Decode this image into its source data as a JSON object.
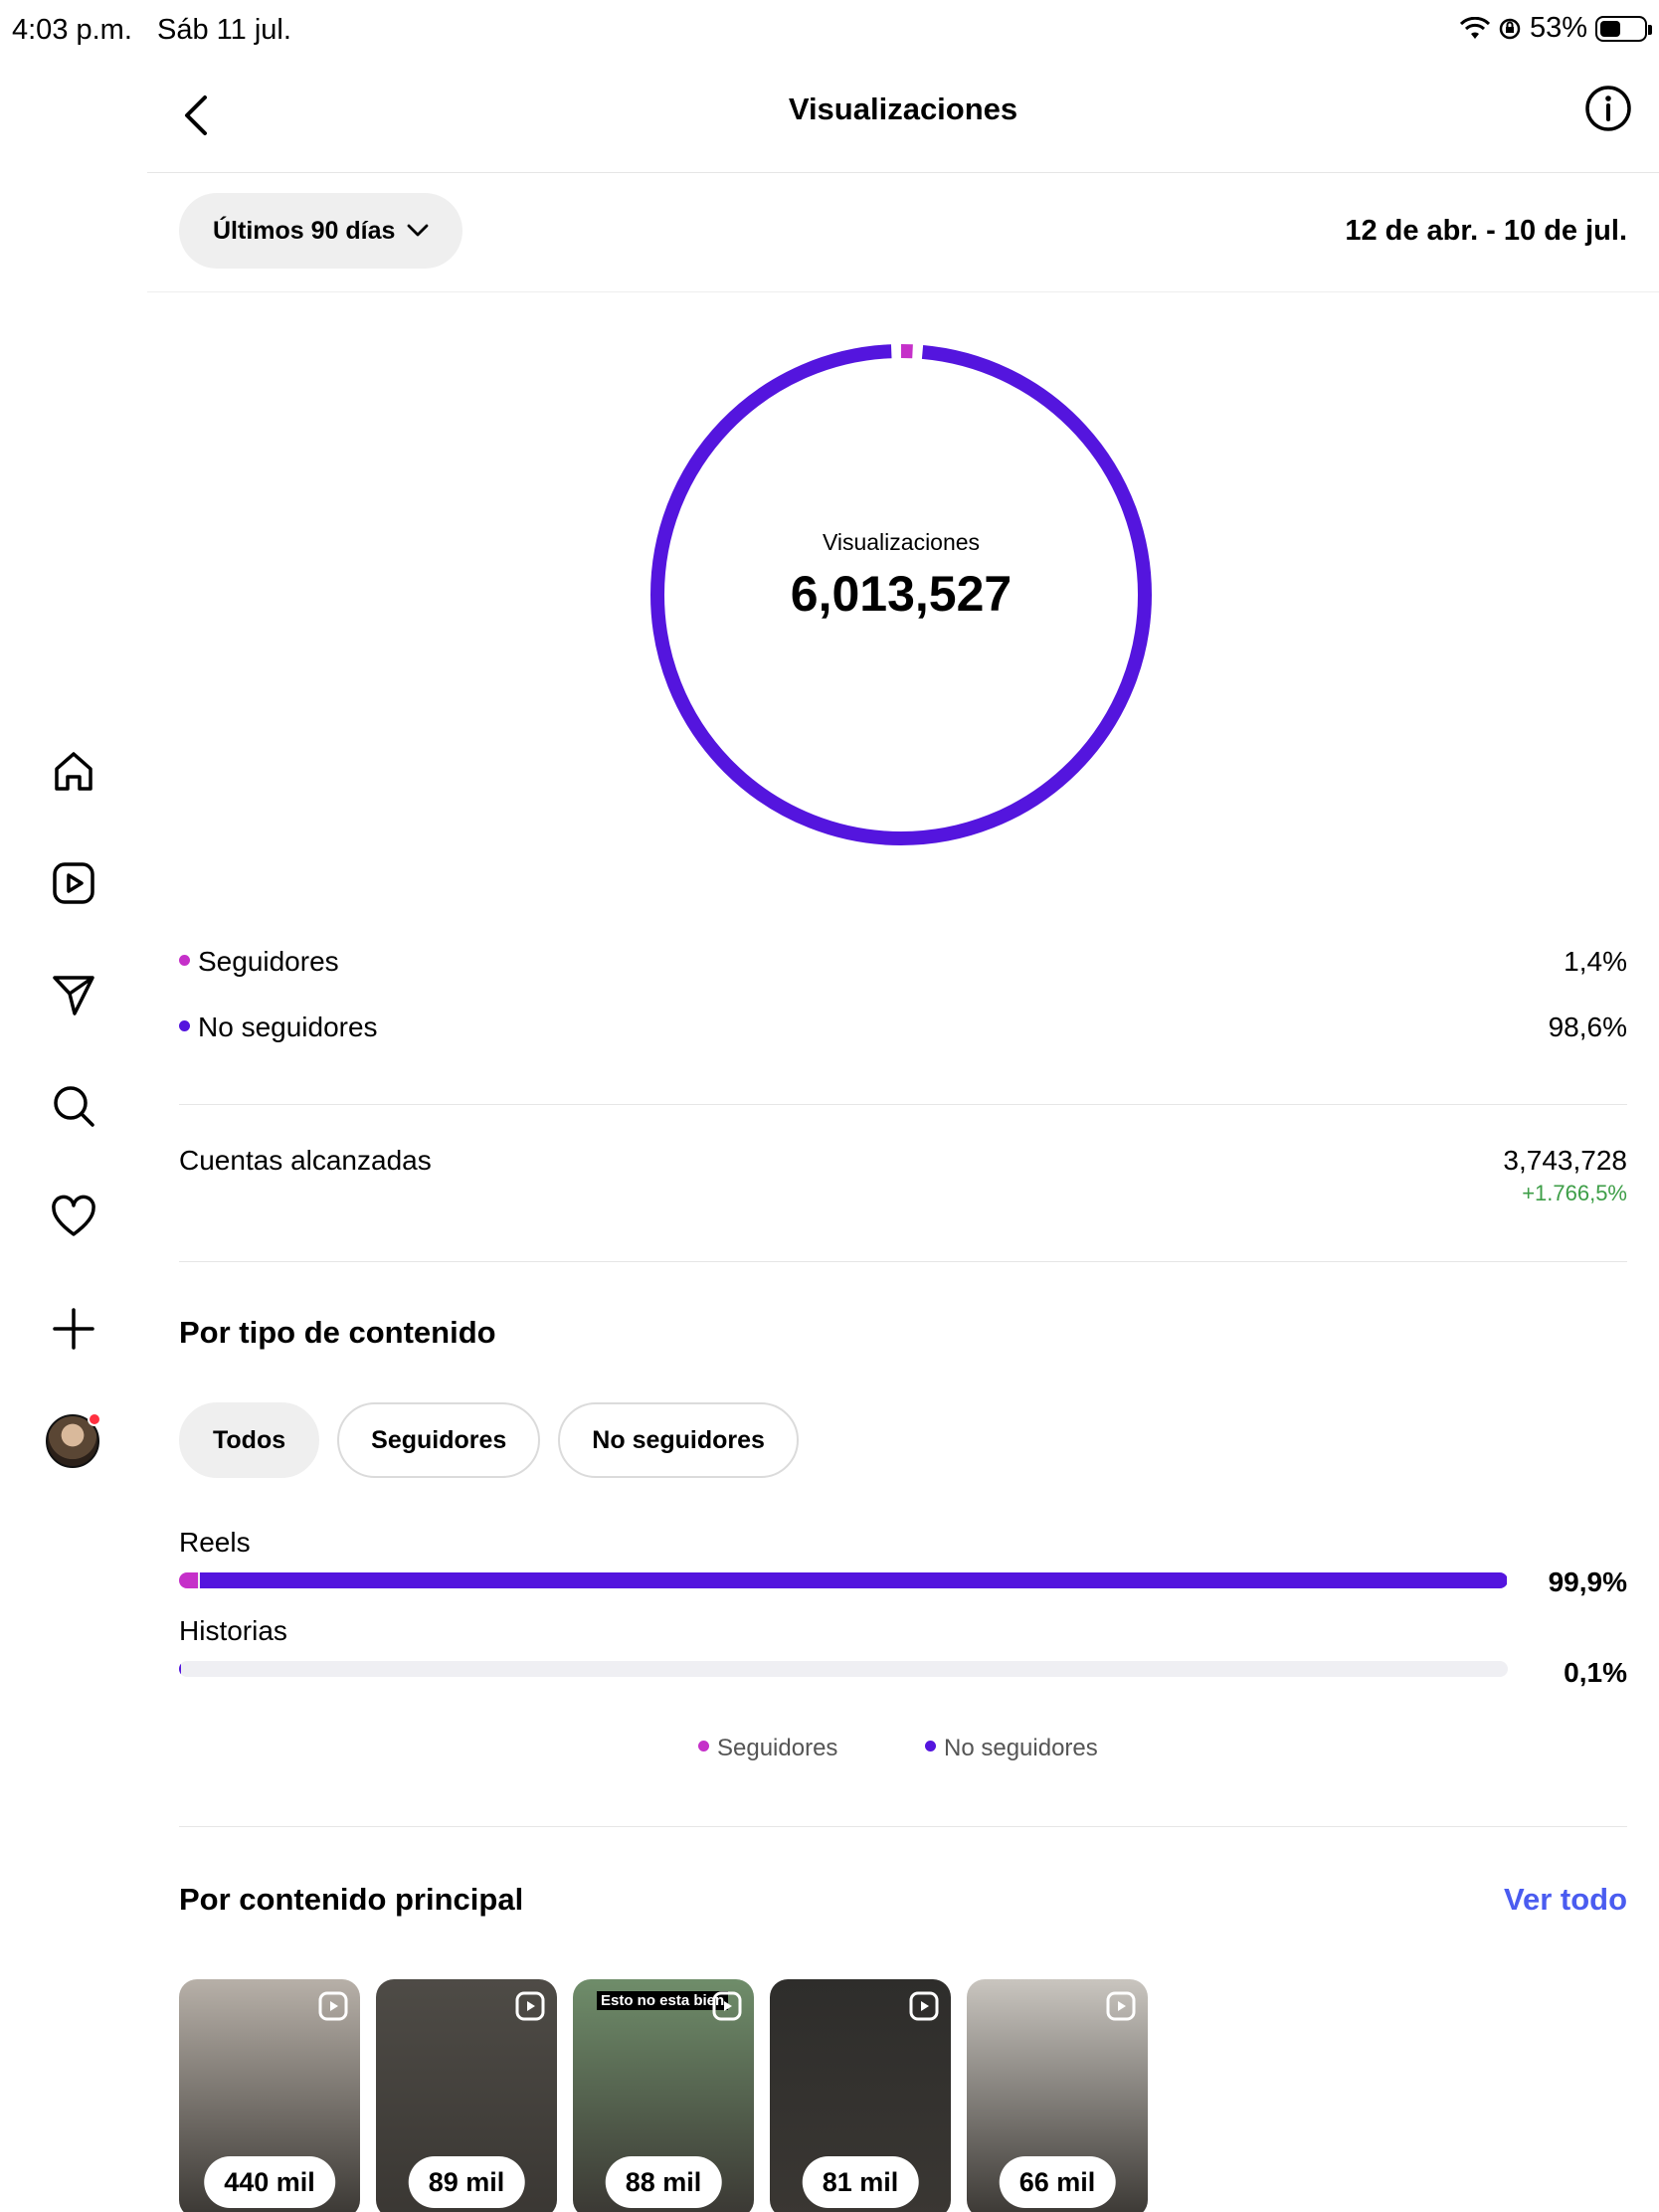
{
  "status_bar": {
    "time": "4:03 p.m.",
    "date": "Sáb 11 jul.",
    "battery": "53%"
  },
  "header": {
    "title": "Visualizaciones"
  },
  "period": {
    "selector_label": "Últimos 90 días",
    "range": "12 de abr. - 10 de jul."
  },
  "summary": {
    "center_label": "Visualizaciones",
    "center_value": "6,013,527"
  },
  "audience": [
    {
      "label": "Seguidores",
      "value": "1,4%",
      "color": "#c530c9",
      "share": 0.014
    },
    {
      "label": "No seguidores",
      "value": "98,6%",
      "color": "#5415de",
      "share": 0.986
    }
  ],
  "reach": {
    "label": "Cuentas alcanzadas",
    "value": "3,743,728",
    "delta": "+1.766,5%"
  },
  "content_type": {
    "title": "Por tipo de contenido",
    "filters": [
      "Todos",
      "Seguidores",
      "No seguidores"
    ],
    "active_filter": 0,
    "bars": [
      {
        "label": "Reels",
        "value": "99,9%",
        "share": 0.999,
        "followers_share": 0.014
      },
      {
        "label": "Historias",
        "value": "0,1%",
        "share": 0.001,
        "followers_share": 0.0
      }
    ],
    "legend": [
      {
        "label": "Seguidores",
        "color": "#c530c9"
      },
      {
        "label": "No seguidores",
        "color": "#5415de"
      }
    ]
  },
  "top_content": {
    "title": "Por contenido principal",
    "see_all": "Ver todo",
    "items": [
      {
        "views": "440 mil",
        "caption": "",
        "bg": "#b7b0a8"
      },
      {
        "views": "89 mil",
        "caption": "",
        "bg": "#4e4b46"
      },
      {
        "views": "88 mil",
        "caption": "Esto no esta bien",
        "bg": "#6f8d6a"
      },
      {
        "views": "81 mil",
        "caption": "",
        "bg": "#2e2d2b"
      },
      {
        "views": "66 mil",
        "caption": "",
        "bg": "#c9c5bf"
      }
    ]
  }
}
